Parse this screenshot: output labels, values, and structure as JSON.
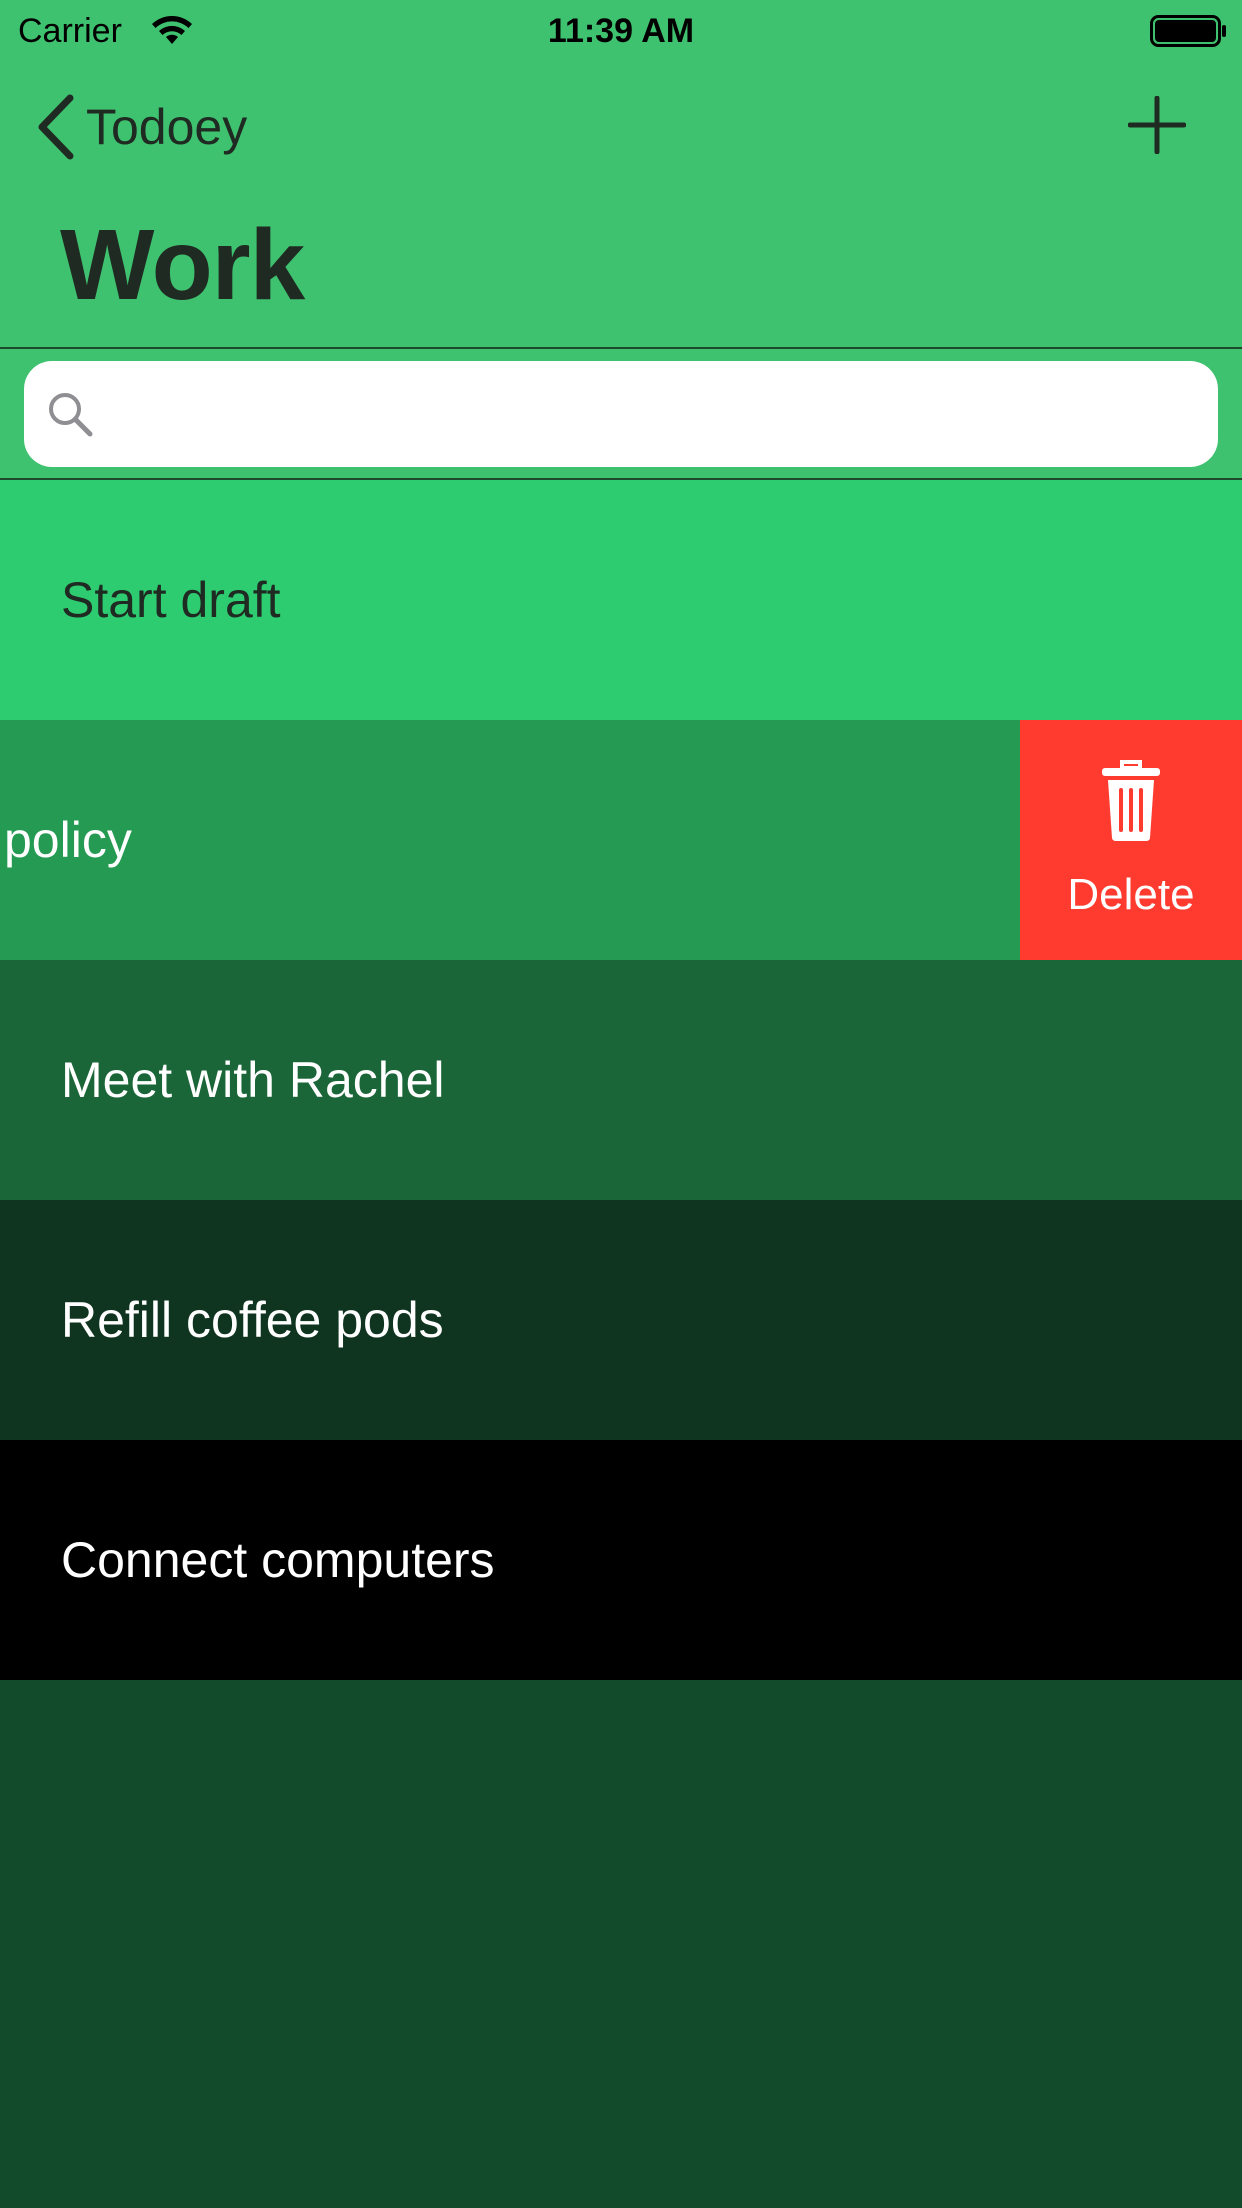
{
  "status_bar": {
    "carrier": "Carrier",
    "time": "11:39 AM",
    "wifi_icon": "wifi-icon",
    "battery_icon": "battery-full-icon"
  },
  "nav": {
    "back_label": "Todoey",
    "back_icon": "chevron-left-icon",
    "add_icon": "plus-icon",
    "title": "Work",
    "bar_color": "#3fc26f"
  },
  "search": {
    "placeholder": "",
    "value": "",
    "icon": "magnifying-glass-icon"
  },
  "items": [
    {
      "label": "Start draft",
      "bg": "#2ecc71",
      "fg": "#1f2a22"
    },
    {
      "label": "policy",
      "bg": "#249a52",
      "fg": "#ffffff",
      "swiped": true
    },
    {
      "label": "Meet with Rachel",
      "bg": "#1b6638",
      "fg": "#ffffff"
    },
    {
      "label": "Refill coffee pods",
      "bg": "#0f3520",
      "fg": "#ffffff"
    },
    {
      "label": "Connect computers",
      "bg": "#000000",
      "fg": "#ffffff"
    }
  ],
  "swipe_action": {
    "label": "Delete",
    "icon": "trash-icon",
    "color": "#ff3b30"
  },
  "empty_background": "#114b2c"
}
